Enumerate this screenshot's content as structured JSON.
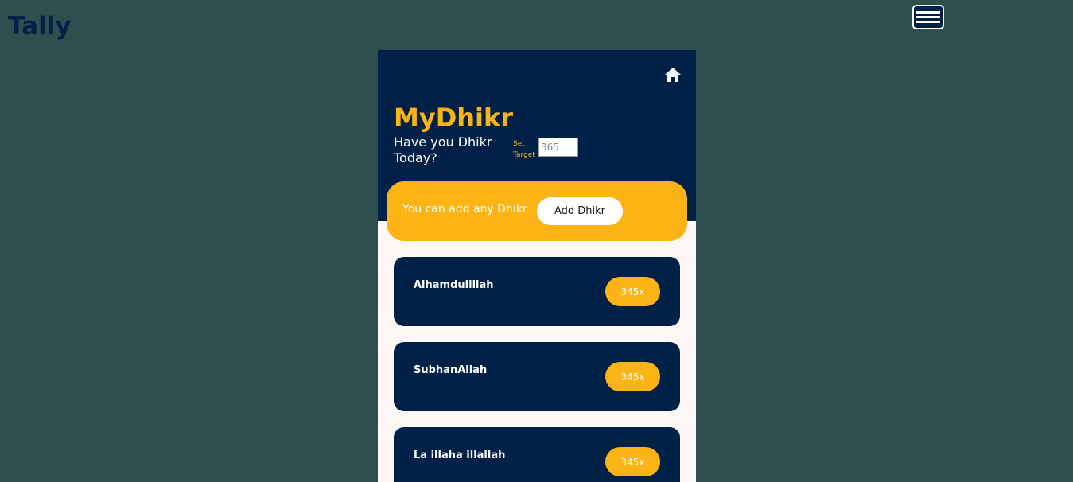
{
  "site": {
    "brand": "Tally"
  },
  "app": {
    "title": "MyDhikr",
    "subtitle": "Have you Dhikr Today?",
    "target_label": "Set Target",
    "target_placeholder": "365",
    "add_card_text": "You can add any Dhikr",
    "add_button_label": "Add Dhikr"
  },
  "dhikrs": [
    {
      "name": "Alhamdulillah",
      "count": "345x"
    },
    {
      "name": "SubhanAllah",
      "count": "345x"
    },
    {
      "name": "La illaha illallah",
      "count": "345x"
    }
  ],
  "colors": {
    "page_background": "#2f4f4f",
    "navy": "#002147",
    "accent": "#fcb316",
    "panel_background": "#fdf8f6"
  },
  "icons": {
    "menu": "hamburger-menu-icon",
    "home": "home-icon"
  }
}
